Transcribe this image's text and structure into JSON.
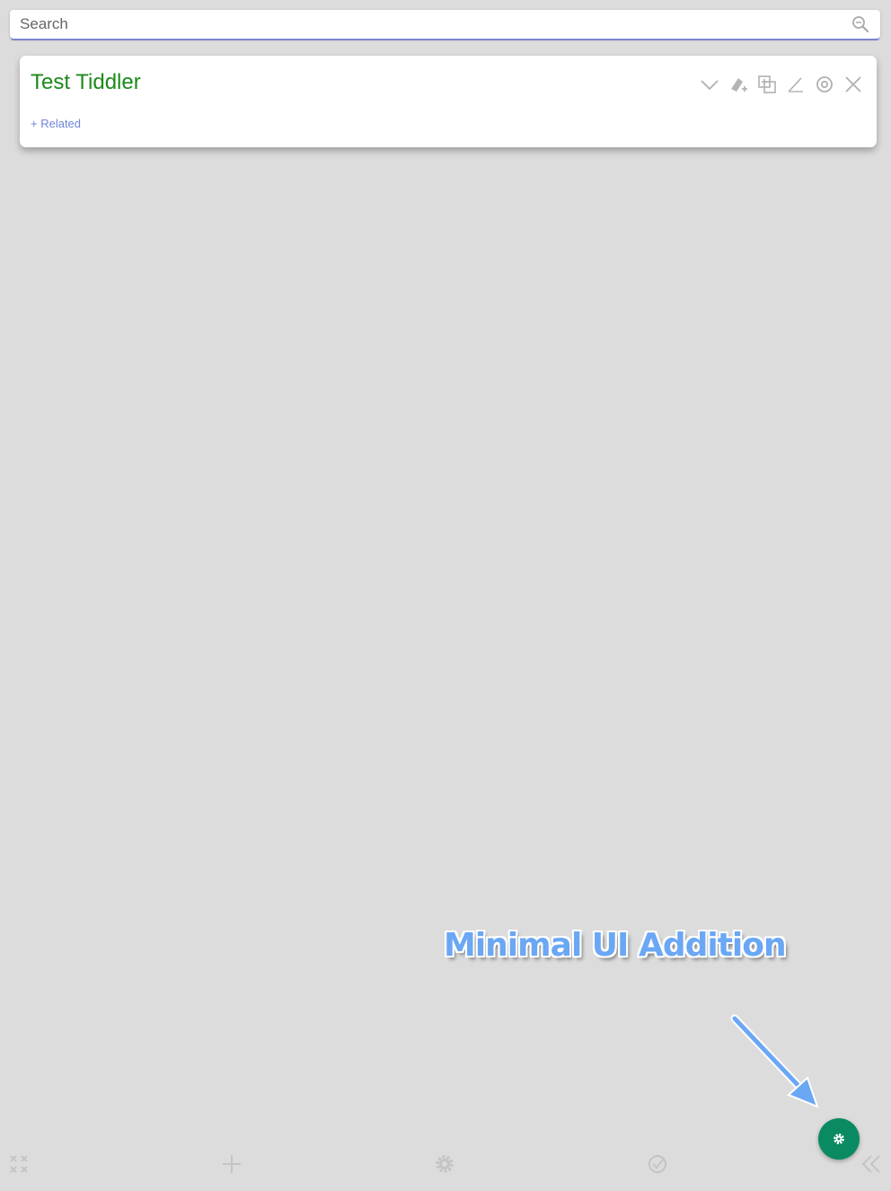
{
  "search": {
    "placeholder": "Search",
    "value": "",
    "icon": "search-icon"
  },
  "tiddler": {
    "title": "Test Tiddler",
    "title_color": "#1c8a1c",
    "related_label": "+ Related",
    "toolbar_icons": [
      "chevron-down-icon",
      "tag-add-icon",
      "clone-icon",
      "edit-icon",
      "info-icon",
      "close-icon"
    ]
  },
  "annotation": {
    "text": "Minimal UI Addition",
    "color": "#6aa7f4"
  },
  "fab": {
    "icon": "gear-icon",
    "color": "#0a8a62"
  },
  "bottom_bar": {
    "icons": [
      "close-all-icon",
      "new-tiddler-icon",
      "settings-icon",
      "done-icon",
      "collapse-sidebar-icon"
    ]
  },
  "colors": {
    "background": "#dcdcdc",
    "accent": "#7b86cf",
    "link": "#6f85d6"
  }
}
